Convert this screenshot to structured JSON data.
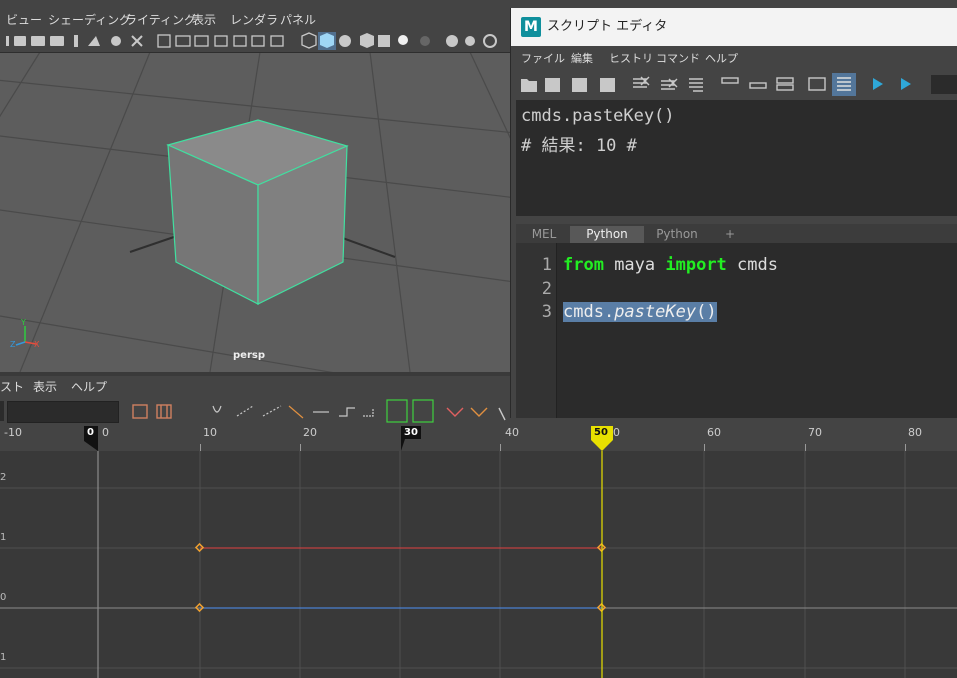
{
  "viewport": {
    "menus": [
      "ビュー",
      "シェーディング",
      "ライティング",
      "表示",
      "レンダラ",
      "パネル"
    ],
    "camera_label": "persp",
    "axis_labels": {
      "x": "X",
      "y": "Y",
      "z": "Z"
    }
  },
  "graph_editor": {
    "menus": [
      "スト",
      "表示",
      "ヘルプ"
    ],
    "ruler_ticks": [
      "-10",
      "0",
      "10",
      "20",
      "30",
      "40",
      "50",
      "60",
      "70",
      "80"
    ],
    "markers": {
      "start": "0",
      "mid": "30",
      "current": "50"
    },
    "y_labels": [
      "2",
      "1",
      "0",
      "1"
    ],
    "current_frame": 50
  },
  "script_editor": {
    "title": "スクリプト エディタ",
    "logo": "M",
    "menus": [
      "ファイル",
      "編集",
      "ヒストリ",
      "コマンド",
      "ヘルプ"
    ],
    "output_lines": [
      "cmds.pasteKey()",
      "# 結果: 10 #"
    ],
    "tabs": [
      "MEL",
      "Python",
      "Python",
      "+"
    ],
    "active_tab_index": 1,
    "line_numbers": [
      "1",
      "2",
      "3"
    ],
    "code": {
      "line1": {
        "kw1": "from",
        "t1": " maya ",
        "kw2": "import",
        "t2": " cmds"
      },
      "line3": {
        "pre": "cmds.",
        "fn": "pasteKey",
        "post": "()"
      }
    }
  }
}
